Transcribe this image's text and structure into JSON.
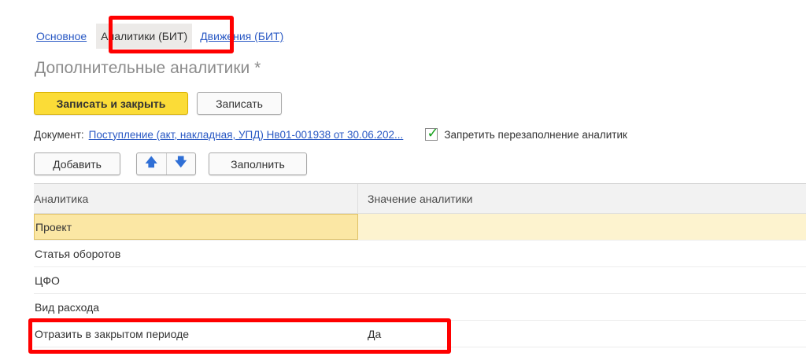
{
  "tabs": {
    "main_label": "Основное",
    "analytics_label": "Аналитики (БИТ)",
    "movements_label": "Движения (БИТ)"
  },
  "form": {
    "title": "Дополнительные аналитики *"
  },
  "toolbar": {
    "save_close_label": "Записать и закрыть",
    "save_label": "Записать"
  },
  "document": {
    "label": "Документ:",
    "link": "Поступление (акт, накладная, УПД) Нв01-001938 от 30.06.202...",
    "checkbox_checked": true,
    "checkbox_label": "Запретить перезаполнение аналитик"
  },
  "table_toolbar": {
    "add_label": "Добавить",
    "up_icon": "arrow-up-icon",
    "down_icon": "arrow-down-icon",
    "fill_label": "Заполнить"
  },
  "table": {
    "columns": [
      "Аналитика",
      "Значение аналитики"
    ],
    "rows": [
      {
        "name": "Проект",
        "value": ""
      },
      {
        "name": "Статья оборотов",
        "value": ""
      },
      {
        "name": "ЦФО",
        "value": ""
      },
      {
        "name": "Вид расхода",
        "value": ""
      },
      {
        "name": "Отразить в закрытом периоде",
        "value": "Да"
      }
    ]
  },
  "colors": {
    "highlight": "#ff0000",
    "primary_button": "#fbdc37",
    "link": "#2a59c4",
    "selected_row": "#fbe7a4"
  }
}
